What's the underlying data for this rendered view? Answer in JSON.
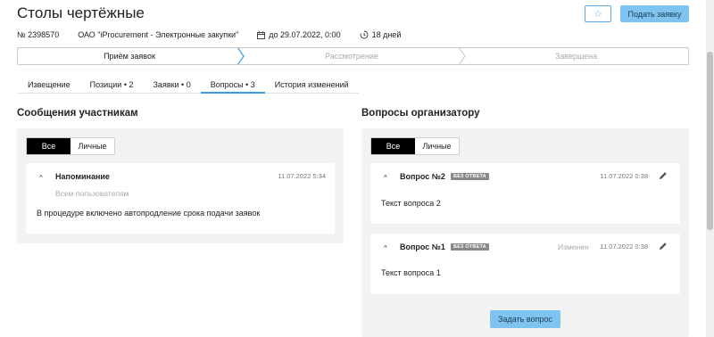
{
  "header": {
    "title": "Столы чертёжные",
    "star_icon": "star-icon",
    "submit_label": "Подать заявку"
  },
  "meta": {
    "number": "№ 2398570",
    "organization": "ОАО \"iProcurement - Электронные закупки\"",
    "deadline": "до 29.07.2022, 0:00",
    "days_left": "18 дней"
  },
  "stepper": {
    "steps": [
      "Приём заявок",
      "Рассмотрение",
      "Завершена"
    ],
    "active_index": 0
  },
  "tabs": [
    {
      "label": "Извещение"
    },
    {
      "label": "Позиции • 2"
    },
    {
      "label": "Заявки • 0"
    },
    {
      "label": "Вопросы • 3"
    },
    {
      "label": "История изменений"
    }
  ],
  "active_tab": 3,
  "messages": {
    "title": "Сообщения участникам",
    "filter": {
      "all": "Все",
      "personal": "Личные",
      "selected": "Все"
    },
    "items": [
      {
        "title": "Напоминание",
        "date": "11.07.2022 5:34",
        "audience": "Всем пользователям",
        "text": "В процедуре включено автопродление срока подачи заявок"
      }
    ]
  },
  "questions": {
    "title": "Вопросы организатору",
    "filter": {
      "all": "Все",
      "personal": "Личные",
      "selected": "Все"
    },
    "items": [
      {
        "title": "Вопрос №2",
        "badge": "БЕЗ ОТВЕТА",
        "date": "11.07.2022 0:38",
        "changed": "",
        "text": "Текст вопроса 2"
      },
      {
        "title": "Вопрос №1",
        "badge": "БЕЗ ОТВЕТА",
        "date": "11.07.2022 0:38",
        "changed": "Изменен",
        "text": "Текст вопроса 1"
      }
    ],
    "ask_label": "Задать вопрос"
  }
}
